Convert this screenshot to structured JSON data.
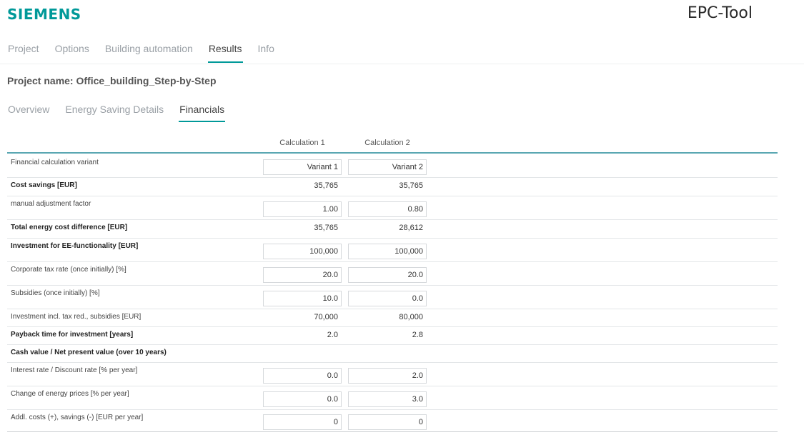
{
  "header": {
    "brand": "SIEMENS",
    "app_title": "EPC-Tool"
  },
  "main_tabs": [
    {
      "label": "Project"
    },
    {
      "label": "Options"
    },
    {
      "label": "Building automation"
    },
    {
      "label": "Results"
    },
    {
      "label": "Info"
    }
  ],
  "active_main_tab": "Results",
  "project_name": "Project name: Office_building_Step-by-Step",
  "sub_tabs": [
    {
      "label": "Overview"
    },
    {
      "label": "Energy Saving Details"
    },
    {
      "label": "Financials"
    }
  ],
  "active_sub_tab": "Financials",
  "table": {
    "columns": [
      "Calculation 1",
      "Calculation 2"
    ],
    "rows": [
      {
        "label": "Financial calculation variant",
        "bold": false,
        "kind": "input",
        "values": [
          "Variant 1",
          "Variant 2"
        ]
      },
      {
        "label": "Cost savings [EUR]",
        "bold": true,
        "kind": "value",
        "values": [
          "35,765",
          "35,765"
        ]
      },
      {
        "label": "manual adjustment factor",
        "bold": false,
        "kind": "input",
        "values": [
          "1.00",
          "0.80"
        ]
      },
      {
        "label": "Total energy cost difference [EUR]",
        "bold": true,
        "kind": "value",
        "values": [
          "35,765",
          "28,612"
        ]
      },
      {
        "label": "Investment for EE-functionality [EUR]",
        "bold": true,
        "kind": "input",
        "values": [
          "100,000",
          "100,000"
        ]
      },
      {
        "label": "Corporate tax rate (once initially) [%]",
        "bold": false,
        "kind": "input",
        "values": [
          "20.0",
          "20.0"
        ]
      },
      {
        "label": "Subsidies (once initially) [%]",
        "bold": false,
        "kind": "input",
        "values": [
          "10.0",
          "0.0"
        ]
      },
      {
        "label": "Investment incl. tax red., subsidies [EUR]",
        "bold": false,
        "kind": "value",
        "values": [
          "70,000",
          "80,000"
        ]
      },
      {
        "label": "Payback time for investment [years]",
        "bold": true,
        "kind": "value",
        "values": [
          "2.0",
          "2.8"
        ]
      },
      {
        "label": "Cash value / Net present value (over 10 years)",
        "bold": true,
        "kind": "section",
        "values": []
      },
      {
        "label": "Interest rate / Discount rate [% per year]",
        "bold": false,
        "kind": "input",
        "values": [
          "0.0",
          "2.0"
        ]
      },
      {
        "label": "Change of energy prices [% per year]",
        "bold": false,
        "kind": "input",
        "values": [
          "0.0",
          "3.0"
        ]
      },
      {
        "label": "Addl. costs (+), savings (-) [EUR per year]",
        "bold": false,
        "kind": "input",
        "values": [
          "0",
          "0"
        ]
      }
    ]
  }
}
